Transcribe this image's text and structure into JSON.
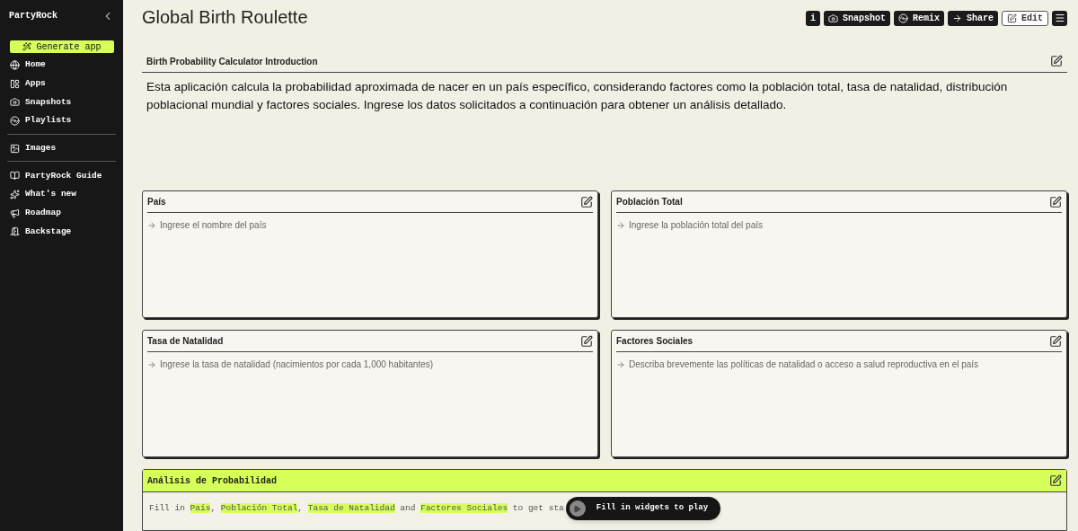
{
  "sidebar": {
    "brand": "PartyRock",
    "generate_button": "Generate app",
    "groups": [
      [
        {
          "kind": "home",
          "label": "Home"
        },
        {
          "kind": "apps",
          "label": "Apps"
        },
        {
          "kind": "snapshots",
          "label": "Snapshots"
        },
        {
          "kind": "playlists",
          "label": "Playlists"
        }
      ],
      [
        {
          "kind": "images",
          "label": "Images"
        }
      ],
      [
        {
          "kind": "guide",
          "label": "PartyRock Guide"
        },
        {
          "kind": "new",
          "label": "What's new"
        },
        {
          "kind": "roadmap",
          "label": "Roadmap"
        },
        {
          "kind": "backstage",
          "label": "Backstage"
        }
      ]
    ]
  },
  "title": "Global Birth Roulette",
  "toolbar": [
    {
      "kind": "info",
      "label": "i"
    },
    {
      "kind": "snapshot",
      "label": "Snapshot"
    },
    {
      "kind": "remix",
      "label": "Remix"
    },
    {
      "kind": "share",
      "label": "Share"
    },
    {
      "kind": "edit",
      "label": "Edit"
    },
    {
      "kind": "menu"
    }
  ],
  "intro": {
    "title": "Birth Probability Calculator Introduction",
    "text": "Esta aplicación calcula la probabilidad aproximada de nacer en un país específico, considerando factores como la población total, tasa de natalidad, distribución poblacional mundial y factores sociales. Ingrese los datos solicitados a continuación para obtener un análisis detallado."
  },
  "inputs": [
    {
      "title": "País",
      "placeholder": "Ingrese el nombre del país"
    },
    {
      "title": "Población Total",
      "placeholder": "Ingrese la población total del país"
    },
    {
      "title": "Tasa de Natalidad",
      "placeholder": "Ingrese la tasa de natalidad (nacimientos por cada 1,000 habitantes)"
    },
    {
      "title": "Factores Sociales",
      "placeholder": "Describa brevemente las políticas de natalidad o acceso a salud reproductiva en el país"
    }
  ],
  "output": {
    "title": "Análisis de Probabilidad",
    "segments": [
      {
        "text": "Fill in ",
        "highlight": false
      },
      {
        "text": "País",
        "highlight": true
      },
      {
        "text": ", ",
        "highlight": false
      },
      {
        "text": "Población Total",
        "highlight": true
      },
      {
        "text": ", ",
        "highlight": false
      },
      {
        "text": "Tasa de Natalidad",
        "highlight": true
      },
      {
        "text": " and ",
        "highlight": false
      },
      {
        "text": "Factores Sociales",
        "highlight": true
      },
      {
        "text": " to get sta",
        "highlight": false
      }
    ]
  },
  "toast": "Fill in widgets to play"
}
